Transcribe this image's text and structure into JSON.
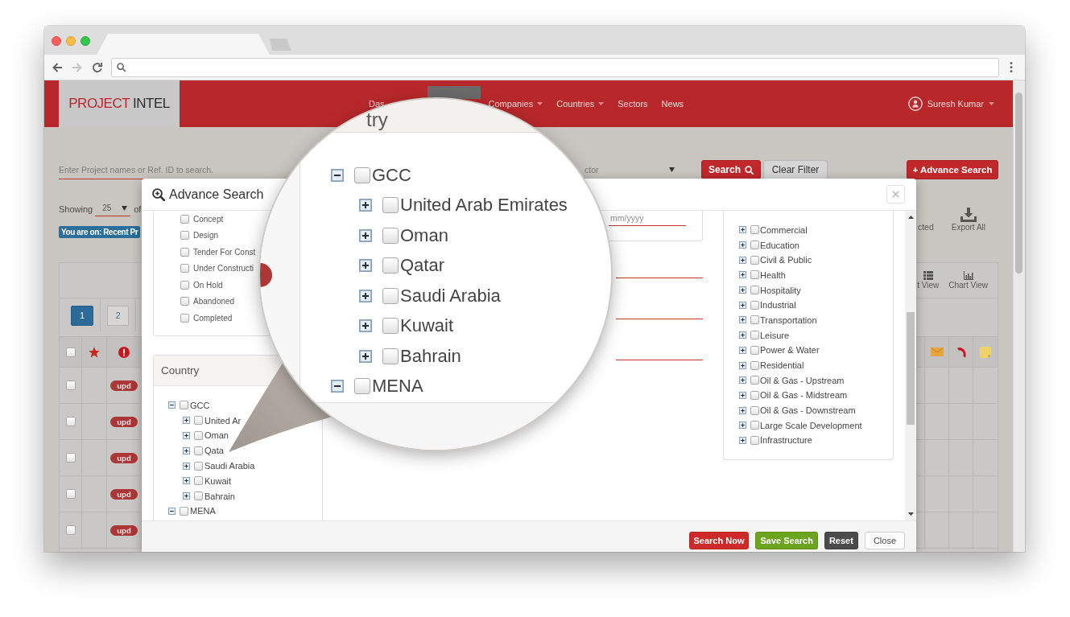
{
  "browser": {
    "tabs": [
      {
        "selected": true
      },
      {
        "selected": false
      }
    ],
    "nav_buttons": [
      {
        "kind": "back",
        "disabled": false
      },
      {
        "kind": "forward",
        "disabled": true
      },
      {
        "kind": "reload",
        "disabled": false
      }
    ]
  },
  "header": {
    "logo": {
      "brand": "PROJECT",
      "product": "INTEL"
    },
    "nav": [
      {
        "label": "Das",
        "selected": false,
        "dropdown": false
      },
      {
        "selected": true,
        "dropdown": false
      },
      {
        "label": "Companies",
        "selected": false,
        "dropdown": true
      },
      {
        "label": "Countries",
        "selected": false,
        "dropdown": true
      },
      {
        "label": "Sectors",
        "selected": false,
        "dropdown": false
      },
      {
        "label": "News",
        "selected": false,
        "dropdown": false
      }
    ],
    "user": {
      "name": "Suresh Kumar",
      "dropdown": true
    }
  },
  "filter_bar": {
    "search": {
      "placeholder": "Enter Project names or Ref. ID to search."
    },
    "sector_select": {
      "placeholder": "ctor"
    },
    "buttons": [
      {
        "label": "Search",
        "kind": "search"
      },
      {
        "label": "Clear Filter",
        "kind": "clear"
      },
      {
        "label": "+ Advance Search",
        "kind": "advance"
      }
    ]
  },
  "listing": {
    "showing_label": "Showing",
    "page_size": "25",
    "of_label": "of",
    "breadcrumb": "You are on: Recent Pr",
    "actions": [
      {
        "label": "cted",
        "kind": "text"
      },
      {
        "label": "Export All",
        "kind": "download"
      }
    ],
    "views": [
      {
        "label": "t View",
        "kind": "list"
      },
      {
        "label": "Chart View",
        "kind": "chart"
      }
    ],
    "pages": [
      {
        "label": "1",
        "selected": true
      },
      {
        "label": "2",
        "selected": false
      }
    ],
    "header_checked": false,
    "rows": [
      {
        "checked": false,
        "badge": "upd"
      },
      {
        "checked": false,
        "badge": "upd"
      },
      {
        "checked": false,
        "badge": "upd"
      },
      {
        "checked": false,
        "badge": "upd"
      },
      {
        "checked": false,
        "badge": "upd"
      }
    ]
  },
  "modal": {
    "title": "Advance Search",
    "status_options": [
      {
        "label": "Concept",
        "checked": false
      },
      {
        "label": "Design",
        "checked": false
      },
      {
        "label": "Tender For Const",
        "checked": false
      },
      {
        "label": "Under Constructi",
        "checked": false
      },
      {
        "label": "On Hold",
        "checked": false
      },
      {
        "label": "Abandoned",
        "checked": false
      },
      {
        "label": "Completed",
        "checked": false
      }
    ],
    "country": {
      "title": "Country",
      "tree": [
        {
          "label": "GCC",
          "checked": false,
          "expanded": true,
          "children": [
            {
              "label": "United Ar",
              "checked": false,
              "expanded": false
            },
            {
              "label": "Oman",
              "checked": false,
              "expanded": false
            },
            {
              "label": "Qata",
              "checked": false,
              "expanded": false
            },
            {
              "label": "Saudi Arabia",
              "checked": false,
              "expanded": false
            },
            {
              "label": "Kuwait",
              "checked": false,
              "expanded": false
            },
            {
              "label": "Bahrain",
              "checked": false,
              "expanded": false
            }
          ]
        },
        {
          "label": "MENA",
          "checked": false,
          "expanded": true
        }
      ]
    },
    "date_field": {
      "placeholder": "mm/yyyy"
    },
    "fields": [
      {
        "kind": "underline"
      },
      {
        "kind": "underline"
      },
      {
        "kind": "underline"
      }
    ],
    "sectors": [
      {
        "label": "Commercial",
        "checked": false,
        "expanded": false
      },
      {
        "label": "Education",
        "checked": false,
        "expanded": false
      },
      {
        "label": "Civil & Public",
        "checked": false,
        "expanded": false
      },
      {
        "label": "Health",
        "checked": false,
        "expanded": false
      },
      {
        "label": "Hospitality",
        "checked": false,
        "expanded": false
      },
      {
        "label": "Industrial",
        "checked": false,
        "expanded": false
      },
      {
        "label": "Transportation",
        "checked": false,
        "expanded": false
      },
      {
        "label": "Leisure",
        "checked": false,
        "expanded": false
      },
      {
        "label": "Power & Water",
        "checked": false,
        "expanded": false
      },
      {
        "label": "Residential",
        "checked": false,
        "expanded": false
      },
      {
        "label": "Oil & Gas - Upstream",
        "checked": false,
        "expanded": false
      },
      {
        "label": "Oil & Gas - Midstream",
        "checked": false,
        "expanded": false
      },
      {
        "label": "Oil & Gas - Downstream",
        "checked": false,
        "expanded": false
      },
      {
        "label": "Large Scale Development",
        "checked": false,
        "expanded": false
      },
      {
        "label": "Infrastructure",
        "checked": false,
        "expanded": false
      }
    ],
    "footer_buttons": [
      {
        "label": "Search Now",
        "kind": "danger"
      },
      {
        "label": "Save Search",
        "kind": "success"
      },
      {
        "label": "Reset",
        "kind": "dark"
      },
      {
        "label": "Close",
        "kind": "default"
      }
    ]
  },
  "magnifier": {
    "header_text": "try",
    "tree": [
      {
        "label": "GCC",
        "checked": false,
        "expanded": true,
        "children": [
          {
            "label": "United Arab Emirates",
            "checked": false,
            "expanded": false
          },
          {
            "label": "Oman",
            "checked": false,
            "expanded": false
          },
          {
            "label": "Qatar",
            "checked": false,
            "expanded": false
          },
          {
            "label": "Saudi Arabia",
            "checked": false,
            "expanded": false
          },
          {
            "label": "Kuwait",
            "checked": false,
            "expanded": false
          },
          {
            "label": "Bahrain",
            "checked": false,
            "expanded": false
          }
        ]
      },
      {
        "label": "MENA",
        "checked": false,
        "expanded": true
      }
    ]
  }
}
